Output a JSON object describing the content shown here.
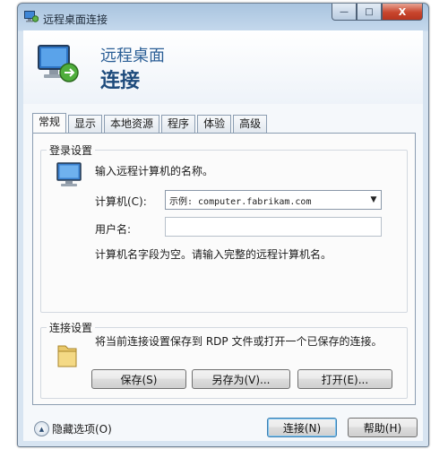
{
  "window": {
    "title": "远程桌面连接"
  },
  "title_buttons": {
    "minimize": "—",
    "maximize": "□",
    "close": "X"
  },
  "header": {
    "line1": "远程桌面",
    "line2": "连接"
  },
  "tabs": [
    {
      "label": "常规"
    },
    {
      "label": "显示"
    },
    {
      "label": "本地资源"
    },
    {
      "label": "程序"
    },
    {
      "label": "体验"
    },
    {
      "label": "高级"
    }
  ],
  "login_group": {
    "label": "登录设置",
    "prompt": "输入远程计算机的名称。",
    "computer_label": "计算机(C):",
    "computer_value": "示例: computer.fabrikam.com",
    "username_label": "用户名:",
    "username_value": "",
    "hint": "计算机名字段为空。请输入完整的远程计算机名。"
  },
  "connection_group": {
    "label": "连接设置",
    "description": "将当前连接设置保存到 RDP 文件或打开一个已保存的连接。",
    "save_label": "保存(S)",
    "save_as_label": "另存为(V)...",
    "open_label": "打开(E)..."
  },
  "footer": {
    "hide_options_label": "隐藏选项(O)",
    "connect_label": "连接(N)",
    "help_label": "帮助(H)"
  },
  "colors": {
    "accent": "#2b5f96",
    "title_bar": "#a9c4df",
    "close_button": "#c8452d"
  }
}
